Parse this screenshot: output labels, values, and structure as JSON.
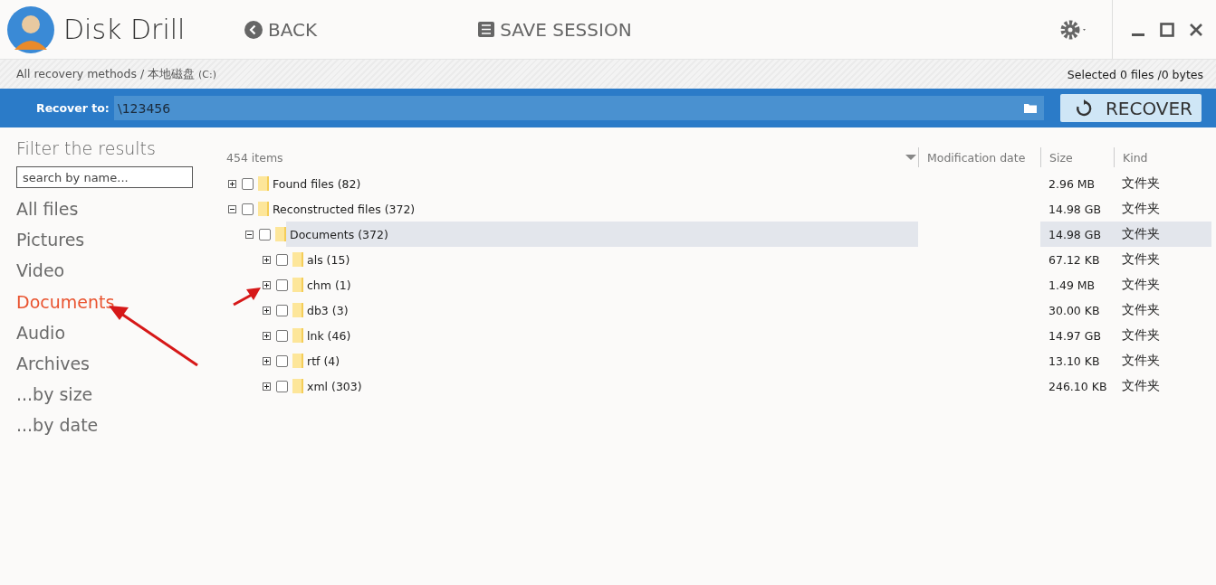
{
  "app": {
    "title": "Disk Drill"
  },
  "toolbar": {
    "back": "BACK",
    "save_session": "SAVE SESSION"
  },
  "breadcrumb": {
    "path": "All recovery methods / 本地磁盘",
    "drive": "(C:)",
    "selection": "Selected 0 files /0 bytes"
  },
  "recover_bar": {
    "label": "Recover to:",
    "value": "\\123456",
    "button": "RECOVER"
  },
  "sidebar": {
    "title": "Filter the results",
    "search": {
      "placeholder": "search by name..."
    },
    "items": [
      {
        "label": "All files",
        "selected": false
      },
      {
        "label": "Pictures",
        "selected": false
      },
      {
        "label": "Video",
        "selected": false
      },
      {
        "label": "Documents",
        "selected": true
      },
      {
        "label": "Audio",
        "selected": false
      },
      {
        "label": "Archives",
        "selected": false
      },
      {
        "label": "...by size",
        "selected": false
      },
      {
        "label": "...by date",
        "selected": false
      }
    ]
  },
  "table": {
    "count": "454 items",
    "columns": [
      "Modification date",
      "Size",
      "Kind"
    ],
    "rows": [
      {
        "name": "Found files (82)",
        "size": "2.96 MB",
        "kind": "文件夹",
        "checked": false,
        "expanded": false,
        "selected": false
      },
      {
        "name": "Reconstructed files (372)",
        "size": "14.98 GB",
        "kind": "文件夹",
        "checked": false,
        "expanded": true,
        "selected": false,
        "children": [
          {
            "name": "Documents (372)",
            "size": "14.98 GB",
            "kind": "文件夹",
            "checked": false,
            "expanded": true,
            "selected": true,
            "children": [
              {
                "name": "als (15)",
                "size": "67.12 KB",
                "kind": "文件夹",
                "checked": false,
                "expanded": false,
                "selected": false
              },
              {
                "name": "chm (1)",
                "size": "1.49 MB",
                "kind": "文件夹",
                "checked": false,
                "expanded": false,
                "selected": false
              },
              {
                "name": "db3 (3)",
                "size": "30.00 KB",
                "kind": "文件夹",
                "checked": false,
                "expanded": false,
                "selected": false
              },
              {
                "name": "lnk (46)",
                "size": "14.97 GB",
                "kind": "文件夹",
                "checked": false,
                "expanded": false,
                "selected": false
              },
              {
                "name": "rtf (4)",
                "size": "13.10 KB",
                "kind": "文件夹",
                "checked": false,
                "expanded": false,
                "selected": false
              },
              {
                "name": "xml (303)",
                "size": "246.10 KB",
                "kind": "文件夹",
                "checked": false,
                "expanded": false,
                "selected": false
              }
            ]
          }
        ]
      }
    ]
  }
}
